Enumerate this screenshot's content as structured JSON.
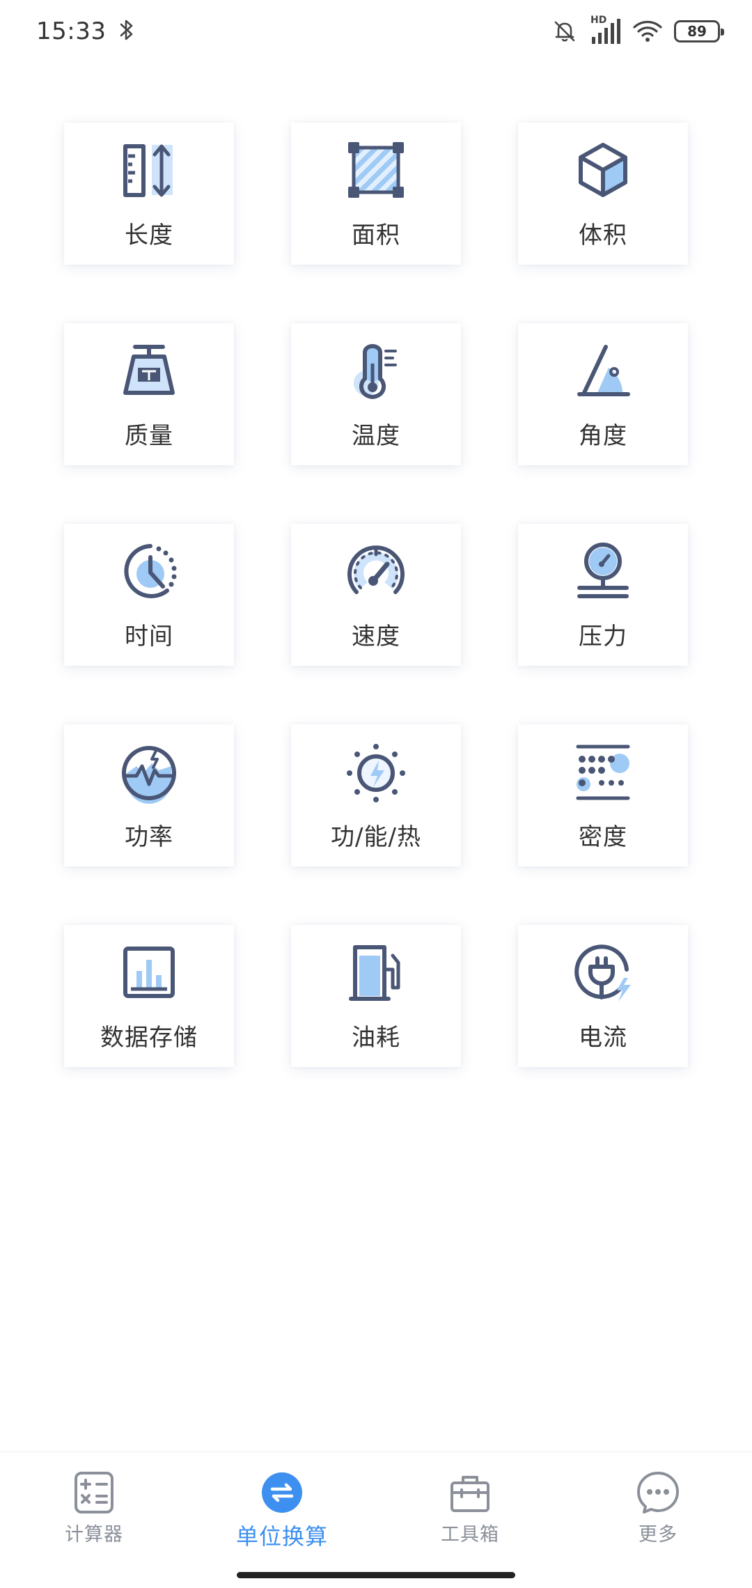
{
  "status_bar": {
    "time": "15:33",
    "battery": "89",
    "network_label": "HD"
  },
  "tiles": [
    {
      "label": "长度",
      "icon": "ruler-icon"
    },
    {
      "label": "面积",
      "icon": "area-square-icon"
    },
    {
      "label": "体积",
      "icon": "cube-icon"
    },
    {
      "label": "质量",
      "icon": "weight-icon"
    },
    {
      "label": "温度",
      "icon": "thermometer-icon"
    },
    {
      "label": "角度",
      "icon": "angle-icon"
    },
    {
      "label": "时间",
      "icon": "clock-icon"
    },
    {
      "label": "速度",
      "icon": "speedometer-icon"
    },
    {
      "label": "压力",
      "icon": "pressure-gauge-icon"
    },
    {
      "label": "功率",
      "icon": "power-icon"
    },
    {
      "label": "功/能/热",
      "icon": "energy-icon"
    },
    {
      "label": "密度",
      "icon": "density-icon"
    },
    {
      "label": "数据存储",
      "icon": "data-chart-icon"
    },
    {
      "label": "油耗",
      "icon": "fuel-pump-icon"
    },
    {
      "label": "电流",
      "icon": "plug-icon"
    }
  ],
  "bottom_nav": {
    "items": [
      {
        "label": "计算器",
        "icon": "calculator-icon",
        "active": false
      },
      {
        "label": "单位换算",
        "icon": "unit-convert-icon",
        "active": true
      },
      {
        "label": "工具箱",
        "icon": "toolbox-icon",
        "active": false
      },
      {
        "label": "更多",
        "icon": "more-icon",
        "active": false
      }
    ]
  },
  "colors": {
    "icon_stroke": "#4a5675",
    "icon_fill_light": "#cfe4fb",
    "icon_fill_mid": "#9fcaf5",
    "accent": "#3d8ff0",
    "nav_inactive": "#8a8f99"
  }
}
